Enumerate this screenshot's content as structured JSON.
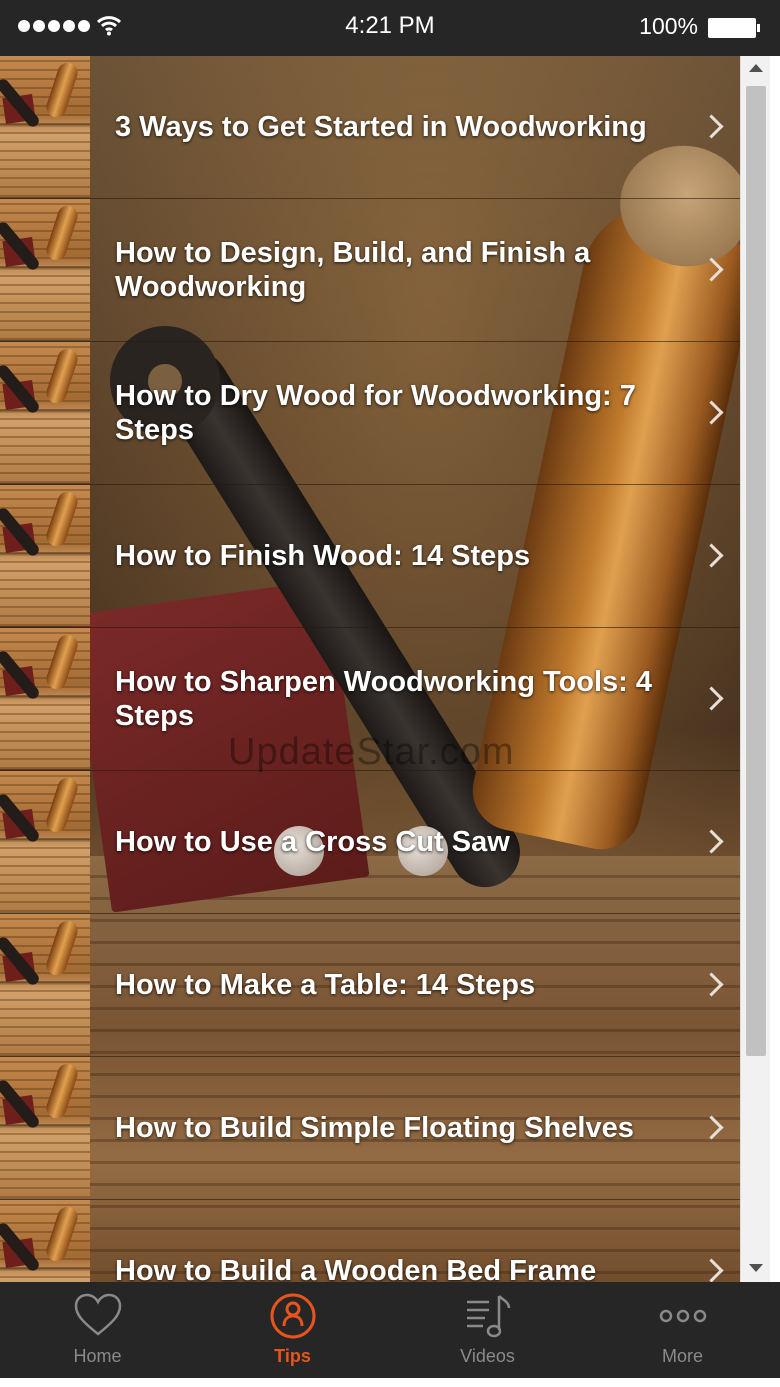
{
  "status_bar": {
    "time": "4:21 PM",
    "battery": "100%"
  },
  "articles": [
    {
      "title": "3 Ways to Get Started in Woodworking"
    },
    {
      "title": "How to Design, Build, and Finish a Woodworking"
    },
    {
      "title": "How to Dry Wood for Woodworking: 7 Steps"
    },
    {
      "title": "How to Finish Wood: 14 Steps"
    },
    {
      "title": "How to Sharpen Woodworking Tools: 4 Steps"
    },
    {
      "title": "How to Use a Cross Cut Saw"
    },
    {
      "title": "How to Make a Table: 14 Steps"
    },
    {
      "title": "How to Build Simple Floating Shelves"
    },
    {
      "title": "How to Build a Wooden Bed Frame"
    }
  ],
  "watermark": "UpdateStar.com",
  "tabbar": {
    "tabs": [
      {
        "label": "Home",
        "icon": "heart-icon"
      },
      {
        "label": "Tips",
        "icon": "user-circle-icon"
      },
      {
        "label": "Videos",
        "icon": "music-list-icon"
      },
      {
        "label": "More",
        "icon": "more-dots-icon"
      }
    ],
    "active_tab": "Tips",
    "active_color": "#e8541c",
    "inactive_color": "#8a8a8a"
  }
}
